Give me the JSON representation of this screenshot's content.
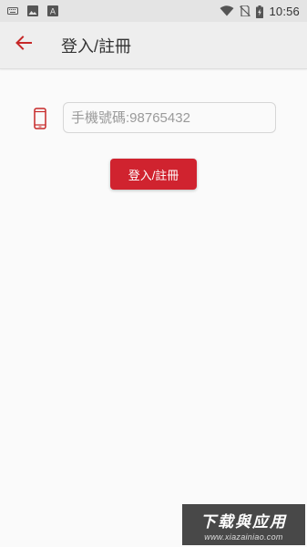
{
  "status_bar": {
    "time": "10:56",
    "icons": [
      "keyboard-icon",
      "image-icon",
      "text-a-icon",
      "wifi-icon",
      "no-sim-icon",
      "battery-charging-icon"
    ],
    "notification_a_label": "A"
  },
  "app_bar": {
    "back_icon": "arrow-left-icon",
    "title": "登入/註冊"
  },
  "login": {
    "phone_icon": "smartphone-icon",
    "phone_placeholder": "手機號碼:98765432",
    "phone_value": "",
    "submit_label": "登入/註冊"
  },
  "watermark": {
    "main": "下载與应用",
    "sub": "www.xiazainiao.com"
  },
  "colors": {
    "accent": "#d0232f",
    "app_bar_bg": "#eeeeee",
    "status_bar_bg": "#e4e4e4",
    "page_bg": "#fafafa"
  }
}
